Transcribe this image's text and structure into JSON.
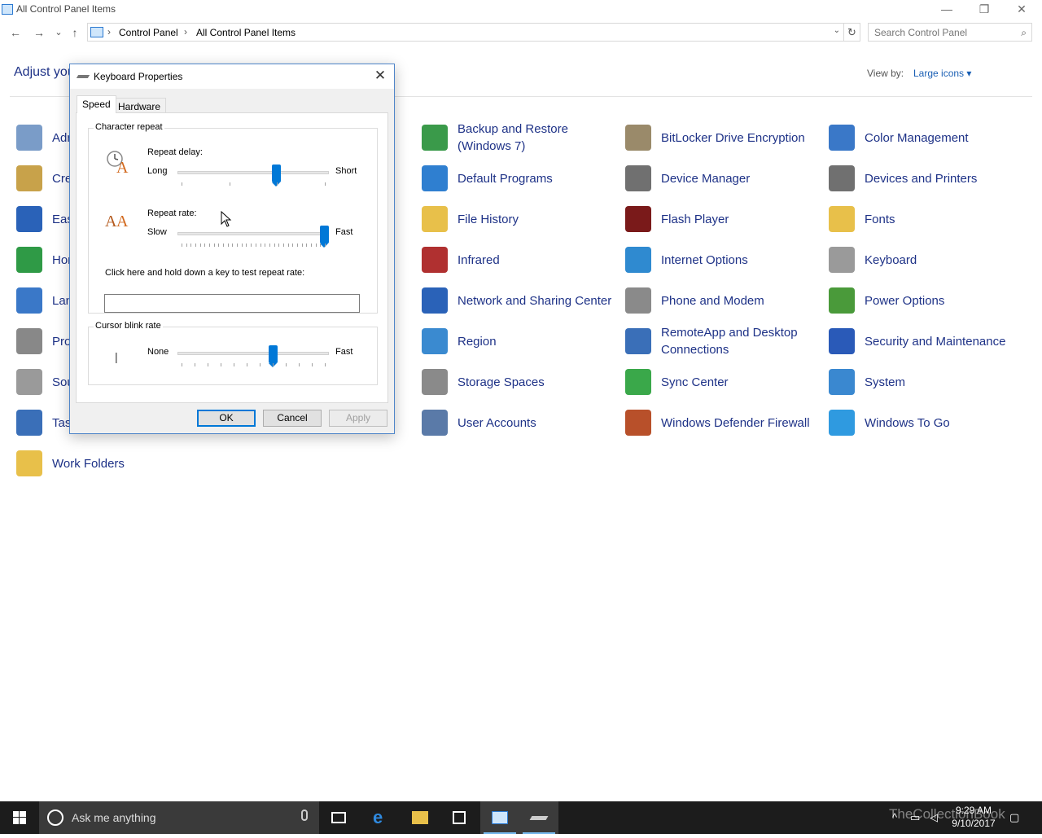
{
  "window": {
    "title": "All Control Panel Items",
    "minimize": "—",
    "restore": "❐",
    "close": "✕"
  },
  "nav": {
    "back": "←",
    "forward": "→",
    "recent": "⌄",
    "up": "↑",
    "breadcrumb": [
      "Control Panel",
      "All Control Panel Items"
    ],
    "refresh": "↻",
    "search_placeholder": "Search Control Panel"
  },
  "content": {
    "heading": "Adjust you",
    "view_by_label": "View by:",
    "view_by_value": "Large icons ▾"
  },
  "items_col1": [
    {
      "label": "Adr",
      "icon": "administrative-tools-icon",
      "color": "#7a9cc8"
    },
    {
      "label": "Cre",
      "icon": "credential-manager-icon",
      "color": "#c8a24a"
    },
    {
      "label": "Eas",
      "icon": "ease-of-access-icon",
      "color": "#2a62b8"
    },
    {
      "label": "Hor",
      "icon": "homegroup-icon",
      "color": "#2f9a46"
    },
    {
      "label": "Lan",
      "icon": "language-icon",
      "color": "#3a78c8"
    },
    {
      "label": "Pro",
      "icon": "programs-icon",
      "color": "#888888"
    },
    {
      "label": "Sou",
      "icon": "sound-icon",
      "color": "#9a9a9a"
    },
    {
      "label": "Tasl",
      "icon": "taskbar-icon",
      "color": "#3a6fb8"
    },
    {
      "label": "Work Folders",
      "icon": "work-folders-icon",
      "color": "#e8c04a"
    }
  ],
  "items_col2": [
    {
      "label": "Backup and Restore (Windows 7)",
      "icon": "backup-restore-icon",
      "color": "#3a9a4a"
    },
    {
      "label": "Default Programs",
      "icon": "default-programs-icon",
      "color": "#2f7fd0"
    },
    {
      "label": "File History",
      "icon": "file-history-icon",
      "color": "#e8c04a"
    },
    {
      "label": "Infrared",
      "icon": "infrared-icon",
      "color": "#b03030"
    },
    {
      "label": "Network and Sharing Center",
      "icon": "network-sharing-icon",
      "color": "#2a62b8"
    },
    {
      "label": "Region",
      "icon": "region-icon",
      "color": "#3a8ad0"
    },
    {
      "label": "Storage Spaces",
      "icon": "storage-spaces-icon",
      "color": "#8a8a8a"
    },
    {
      "label": "User Accounts",
      "icon": "user-accounts-icon",
      "color": "#5a7aa8"
    }
  ],
  "items_col3": [
    {
      "label": "BitLocker Drive Encryption",
      "icon": "bitlocker-icon",
      "color": "#9a8a6a"
    },
    {
      "label": "Device Manager",
      "icon": "device-manager-icon",
      "color": "#707070"
    },
    {
      "label": "Flash Player",
      "icon": "flash-player-icon",
      "color": "#7a1a1a"
    },
    {
      "label": "Internet Options",
      "icon": "internet-options-icon",
      "color": "#2f8ad0"
    },
    {
      "label": "Phone and Modem",
      "icon": "phone-modem-icon",
      "color": "#8a8a8a"
    },
    {
      "label": "RemoteApp and Desktop Connections",
      "icon": "remoteapp-icon",
      "color": "#3a6fb8"
    },
    {
      "label": "Sync Center",
      "icon": "sync-center-icon",
      "color": "#3aa84a"
    },
    {
      "label": "Windows Defender Firewall",
      "icon": "firewall-icon",
      "color": "#b8502a"
    }
  ],
  "items_col4": [
    {
      "label": "Color Management",
      "icon": "color-management-icon",
      "color": "#3a78c8"
    },
    {
      "label": "Devices and Printers",
      "icon": "devices-printers-icon",
      "color": "#707070"
    },
    {
      "label": "Fonts",
      "icon": "fonts-icon",
      "color": "#e8c04a"
    },
    {
      "label": "Keyboard",
      "icon": "keyboard-icon",
      "color": "#9a9a9a"
    },
    {
      "label": "Power Options",
      "icon": "power-options-icon",
      "color": "#4a9a3a"
    },
    {
      "label": "Security and Maintenance",
      "icon": "security-maintenance-icon",
      "color": "#2a5ab8"
    },
    {
      "label": "System",
      "icon": "system-icon",
      "color": "#3a88d0"
    },
    {
      "label": "Windows To Go",
      "icon": "windows-to-go-icon",
      "color": "#2f9ae0"
    }
  ],
  "dialog": {
    "title": "Keyboard Properties",
    "close": "✕",
    "tabs": [
      "Speed",
      "Hardware"
    ],
    "char_repeat_group": "Character repeat",
    "repeat_delay_label": "Repeat delay:",
    "repeat_delay_min": "Long",
    "repeat_delay_max": "Short",
    "repeat_delay_value": 0.66,
    "repeat_rate_label": "Repeat rate:",
    "repeat_rate_min": "Slow",
    "repeat_rate_max": "Fast",
    "repeat_rate_value": 1.0,
    "test_label": "Click here and hold down a key to test repeat rate:",
    "cursor_blink_group": "Cursor blink rate",
    "cursor_blink_min": "None",
    "cursor_blink_max": "Fast",
    "cursor_blink_value": 0.64,
    "cursor_sample": "|",
    "ok": "OK",
    "cancel": "Cancel",
    "apply": "Apply"
  },
  "taskbar": {
    "search_text": "Ask me anything",
    "time": "9:29 AM",
    "date": "9/10/2017",
    "watermark": "TheCollectionBook"
  },
  "colors": {
    "link": "#1e3287",
    "accent": "#0078d7",
    "taskbar": "#1c1c1c"
  }
}
